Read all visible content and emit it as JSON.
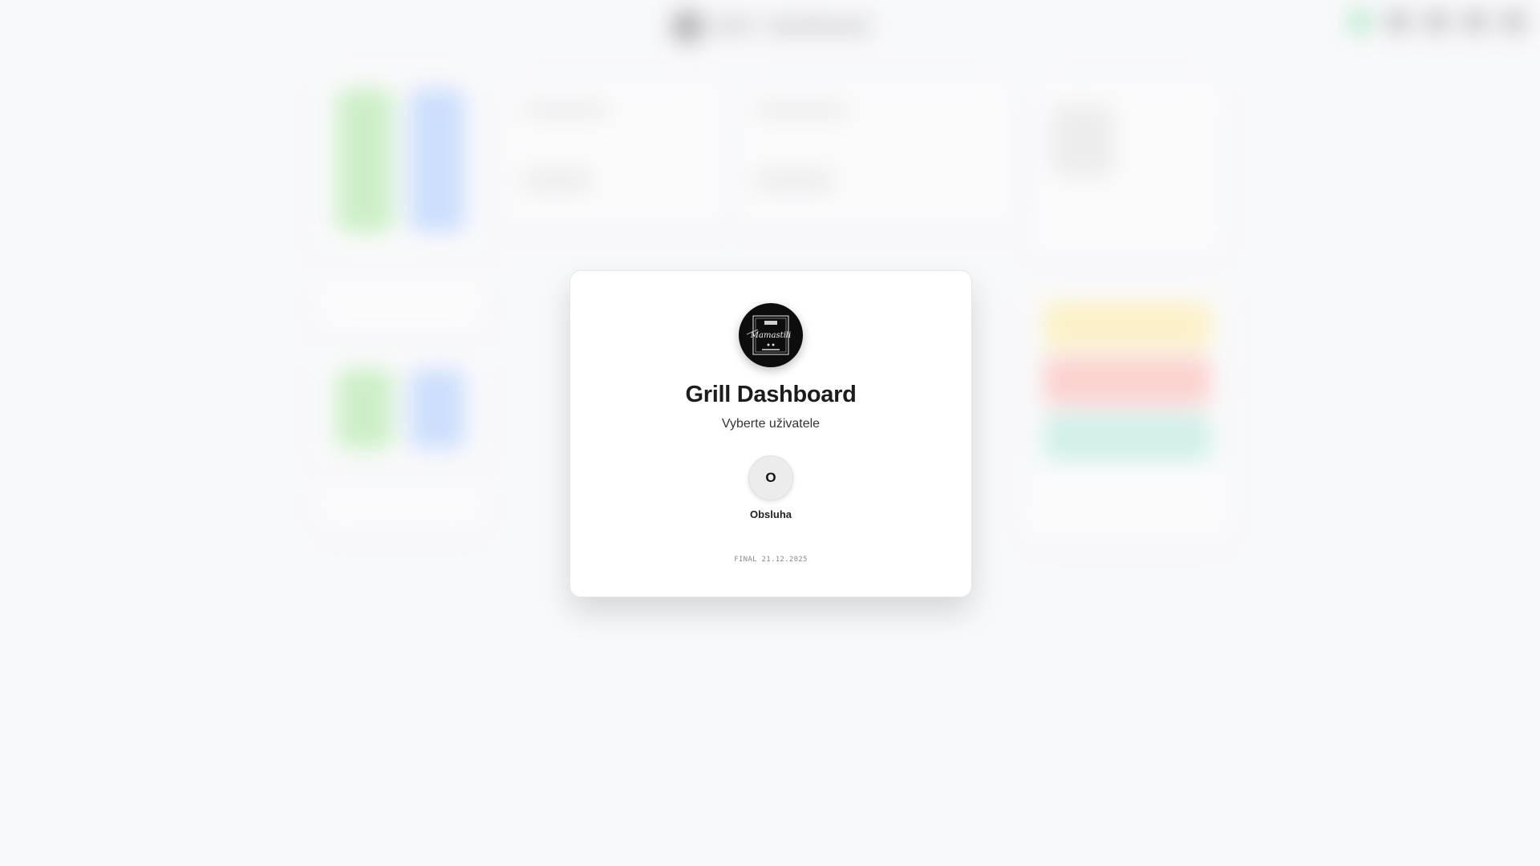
{
  "background": {
    "header_title": "Grill - Dashboard",
    "icons": [
      "refresh-icon",
      "fullscreen-icon",
      "download-icon",
      "settings-icon",
      "stats-icon"
    ]
  },
  "modal": {
    "logo_text": "Mamastili",
    "title": "Grill Dashboard",
    "subtitle": "Vyberte uživatele",
    "users": [
      {
        "initial": "O",
        "name": "Obsluha"
      }
    ],
    "version": "FINAL 21.12.2025"
  },
  "colors": {
    "accent_green": "#3ccf6e",
    "card_bg": "#ffffff",
    "page_bg": "#f8f9fb"
  }
}
